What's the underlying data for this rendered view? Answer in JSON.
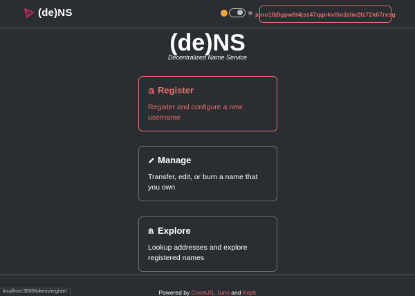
{
  "navbar": {
    "brand": "(de)NS",
    "wallet_address": "juno10j9gpw9t4jsz47qgnkvl5n3zlm2fz72k67rxsg"
  },
  "hero": {
    "title": "(de)NS",
    "subtitle": "Decentralized Name Service"
  },
  "cards": [
    {
      "icon": "bank-icon",
      "title": "Register",
      "description": "Register and configure a new username"
    },
    {
      "icon": "pencil-icon",
      "title": "Manage",
      "description": "Transfer, edit, or burn a name that you own"
    },
    {
      "icon": "books-icon",
      "title": "Explore",
      "description": "Lookup addresses and explore registered names"
    }
  ],
  "footer": {
    "powered_by": "Powered by",
    "link1": "CosmJS",
    "sep1": ",",
    "link2": "Juno",
    "and": "and",
    "link3": "Keplr"
  },
  "status_bar": {
    "url": "localhost:3000/tokens/register"
  },
  "colors": {
    "background": "#2a2d32",
    "accent": "#e8706a",
    "border": "#6a6d73"
  }
}
